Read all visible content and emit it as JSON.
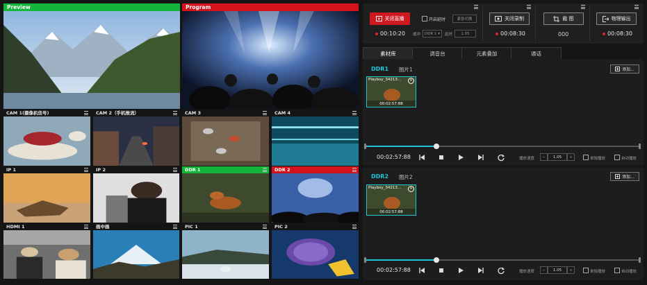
{
  "preview": {
    "label": "Preview"
  },
  "program": {
    "label": "Program"
  },
  "tiles": [
    {
      "label": "CAM 1(摄像机信号)",
      "head": "dark"
    },
    {
      "label": "CAM 2（手机推流）",
      "head": "dark"
    },
    {
      "label": "CAM 3",
      "head": "dark"
    },
    {
      "label": "CAM 4",
      "head": "dark"
    },
    {
      "label": "IP 1",
      "head": "dark"
    },
    {
      "label": "IP 2",
      "head": "dark"
    },
    {
      "label": "DDR 1",
      "head": "green"
    },
    {
      "label": "DDR 2",
      "head": "red"
    },
    {
      "label": "HDMI 1",
      "head": "dark"
    },
    {
      "label": "画中画",
      "head": "dark"
    },
    {
      "label": "PIC 1",
      "head": "dark"
    },
    {
      "label": "PIC 2",
      "head": "dark"
    }
  ],
  "topbar": {
    "live_button": "关闭直播",
    "delay_checkbox": "开启延时",
    "emergency_button": "紧急切换",
    "live_timer": "00:10:20",
    "cache_label": "缓冲",
    "cache_value": "DDR 1",
    "delay_label": "延时",
    "delay_value": "1.05",
    "record_button": "关闭录制",
    "record_timer": "00:08:30",
    "screenshot_button": "截  图",
    "screenshot_count": "000",
    "output_button": "物理输出",
    "output_timer": "00:08:30"
  },
  "tabs": [
    "素材库",
    "调音台",
    "元素叠加",
    "通话"
  ],
  "ddr1": {
    "label": "DDR1",
    "name": "图片1",
    "add": "添加...",
    "thumb_title": "Playboy_34213...",
    "thumb_time": "00:02:57:88",
    "time": "00:02:57:88",
    "speed_label": "播放速度",
    "speed_value": "1.05",
    "single_loop": "单独播放",
    "auto_play": "自动播放",
    "progress": 0.26
  },
  "ddr2": {
    "label": "DDR2",
    "name": "图片2",
    "add": "添加...",
    "thumb_title": "Playboy_34213...",
    "thumb_time": "00:02:57:88",
    "time": "00:02:57:88",
    "speed_label": "播放速度",
    "speed_value": "1.05",
    "single_loop": "单独播放",
    "auto_play": "自动播放",
    "progress": 0.26
  },
  "colors": {
    "accent": "#1dc7d8",
    "live_red": "#cf1920",
    "preview_green": "#15b43a",
    "program_red": "#d3121c"
  }
}
